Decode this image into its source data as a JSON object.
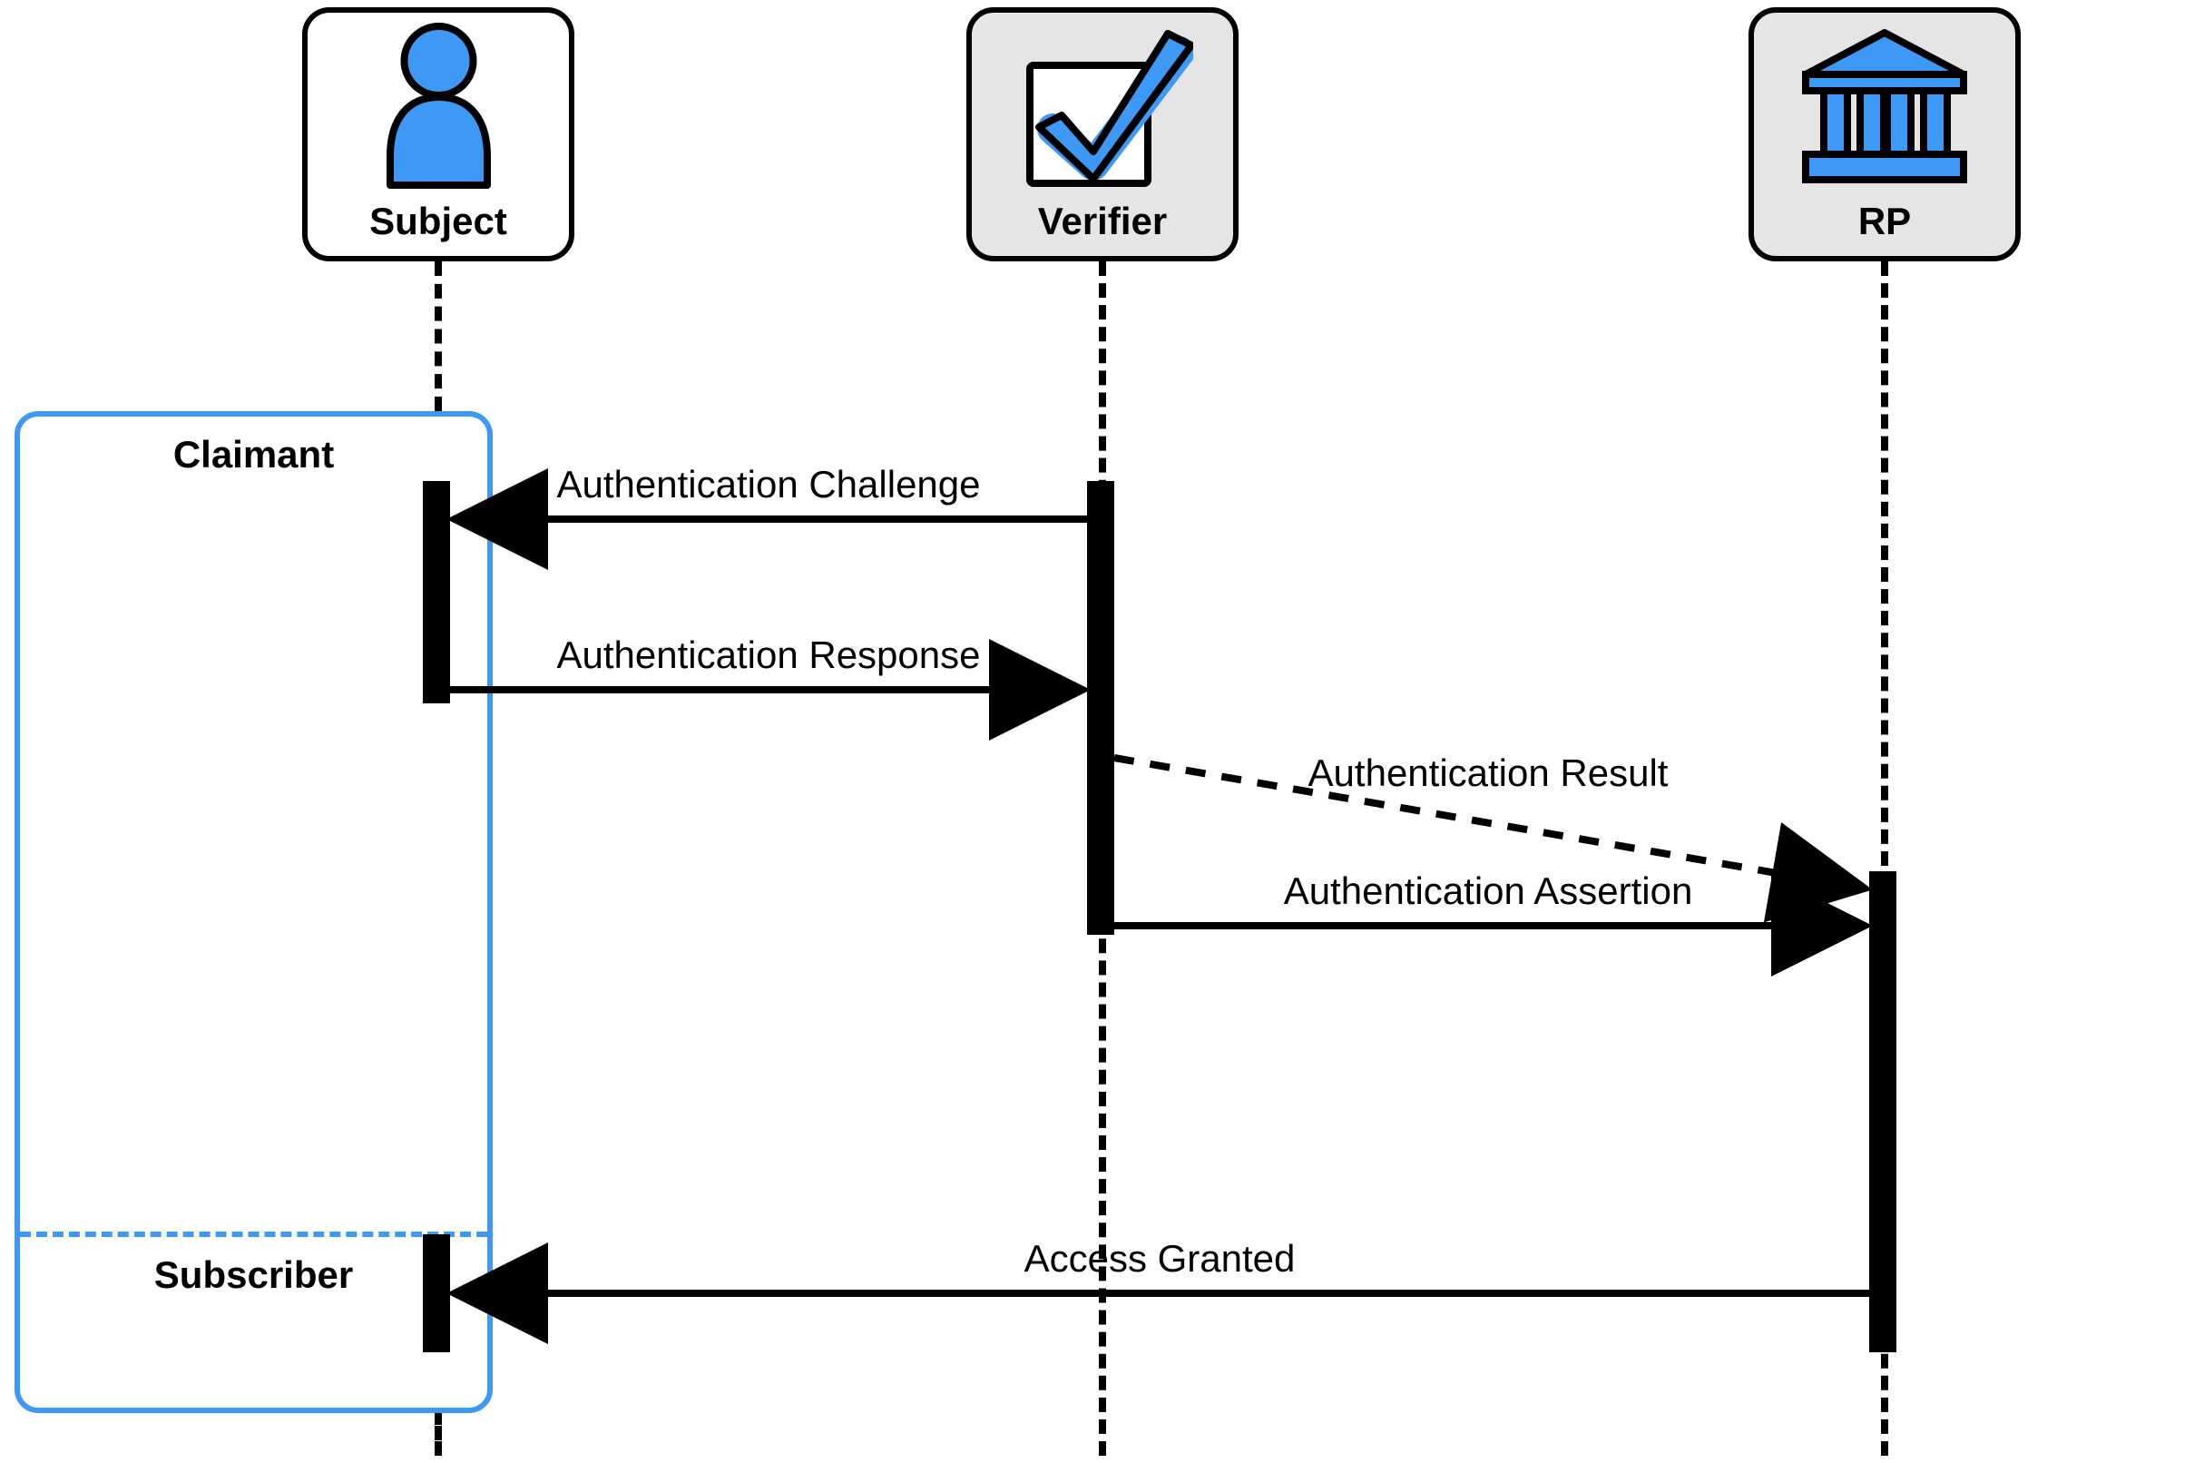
{
  "actors": {
    "subject": {
      "label": "Subject"
    },
    "verifier": {
      "label": "Verifier"
    },
    "rp": {
      "label": "RP"
    }
  },
  "activations": {
    "claimant": {
      "label": "Claimant"
    },
    "subscriber": {
      "label": "Subscriber"
    }
  },
  "messages": {
    "m1": "Authentication Challenge",
    "m2": "Authentication Response",
    "m3": "Authentication Result",
    "m4": "Authentication Assertion",
    "m5": "Access Granted"
  },
  "colors": {
    "accent": "#3d99f5",
    "gray": "#e5e5e5",
    "black": "#000000",
    "white": "#ffffff"
  }
}
